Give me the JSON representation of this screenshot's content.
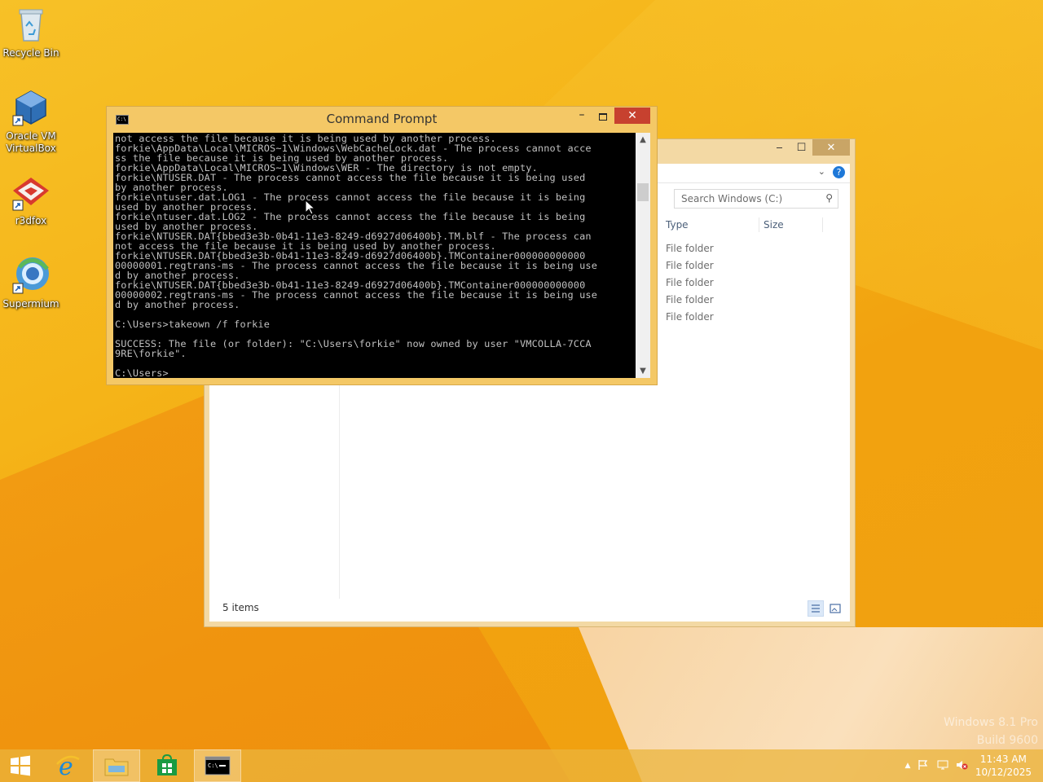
{
  "desktop": {
    "icons": [
      {
        "label": "Recycle Bin",
        "icon": "recycle-bin-icon"
      },
      {
        "label": "Oracle VM VirtualBox",
        "icon": "virtualbox-icon"
      },
      {
        "label": "r3dfox",
        "icon": "r3dfox-icon"
      },
      {
        "label": "Supermium",
        "icon": "supermium-icon"
      }
    ],
    "watermark": {
      "line1": "Windows 8.1 Pro",
      "line2": "Build 9600"
    }
  },
  "explorer": {
    "search_placeholder": "Search Windows (C:)",
    "columns": {
      "type": "Type",
      "size": "Size"
    },
    "rows": [
      {
        "type": "File folder"
      },
      {
        "type": "File folder"
      },
      {
        "type": "File folder"
      },
      {
        "type": "File folder"
      },
      {
        "type": "File folder"
      }
    ],
    "status": "5 items"
  },
  "cmd": {
    "title": "Command Prompt",
    "icon_text": "C:\\",
    "output": "not access the file because it is being used by another process.\nforkie\\AppData\\Local\\MICROS~1\\Windows\\WebCacheLock.dat - The process cannot acce\nss the file because it is being used by another process.\nforkie\\AppData\\Local\\MICROS~1\\Windows\\WER - The directory is not empty.\nforkie\\NTUSER.DAT - The process cannot access the file because it is being used\nby another process.\nforkie\\ntuser.dat.LOG1 - The process cannot access the file because it is being\nused by another process.\nforkie\\ntuser.dat.LOG2 - The process cannot access the file because it is being\nused by another process.\nforkie\\NTUSER.DAT{bbed3e3b-0b41-11e3-8249-d6927d06400b}.TM.blf - The process can\nnot access the file because it is being used by another process.\nforkie\\NTUSER.DAT{bbed3e3b-0b41-11e3-8249-d6927d06400b}.TMContainer000000000000\n00000001.regtrans-ms - The process cannot access the file because it is being use\nd by another process.\nforkie\\NTUSER.DAT{bbed3e3b-0b41-11e3-8249-d6927d06400b}.TMContainer000000000000\n00000002.regtrans-ms - The process cannot access the file because it is being use\nd by another process.\n\nC:\\Users>takeown /f forkie\n\nSUCCESS: The file (or folder): \"C:\\Users\\forkie\" now owned by user \"VMCOLLA-7CCA\n9RE\\forkie\".\n\nC:\\Users>"
  },
  "taskbar": {
    "items": [
      "start-button",
      "internet-explorer",
      "file-explorer",
      "windows-store",
      "command-prompt"
    ],
    "clock": {
      "time": "11:43 AM",
      "date": "10/12/2025"
    }
  }
}
